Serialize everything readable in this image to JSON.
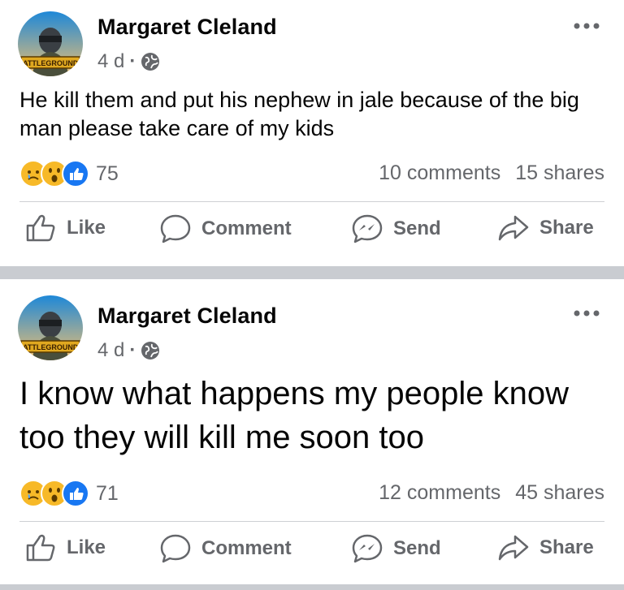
{
  "posts": [
    {
      "author": "Margaret Cleland",
      "time": "4 d",
      "privacy_icon": "globe-icon",
      "avatar_text": "BATTLEGROUNDS",
      "text": "He kill them and put his nephew in jale because of the big man please take care of my kids",
      "reactions_count": "75",
      "comments": "10 comments",
      "shares": "15 shares",
      "actions": {
        "like": "Like",
        "comment": "Comment",
        "send": "Send",
        "share": "Share"
      }
    },
    {
      "author": "Margaret Cleland",
      "time": "4 d",
      "privacy_icon": "globe-icon",
      "avatar_text": "BATTLEGROUNDS",
      "text": "I know what happens my people know too they will kill me soon too",
      "reactions_count": "71",
      "comments": "12 comments",
      "shares": "45 shares",
      "actions": {
        "like": "Like",
        "comment": "Comment",
        "send": "Send",
        "share": "Share"
      }
    }
  ],
  "colors": {
    "secondary_text": "#65676b",
    "like_blue": "#1877f2",
    "emoji_yellow": "#f7b928",
    "separator": "#c9ccd1"
  }
}
